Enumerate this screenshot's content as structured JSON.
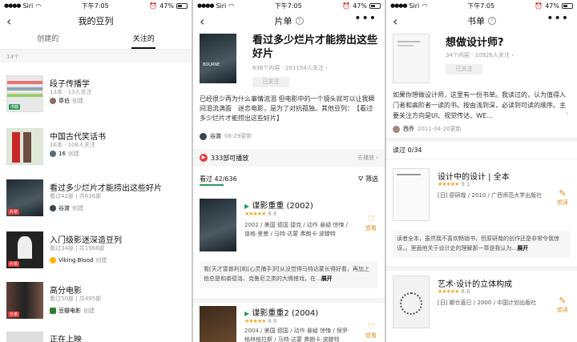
{
  "status": {
    "carrier": "Siri",
    "time": "下午7:05",
    "battery": "47%"
  },
  "p1": {
    "title": "我的豆列",
    "tabs": [
      "创建的",
      "关注的"
    ],
    "count": "14个",
    "items": [
      {
        "title": "段子传播学",
        "meta": "13本 · 13人关注",
        "author": "章伯",
        "role": "创建",
        "tag": "书籍"
      },
      {
        "title": "中国古代笑话书",
        "meta": "16本 · 108人关注",
        "author": "16",
        "role": "创建",
        "tag": ""
      },
      {
        "title": "看过多少烂片才能捞出这些好片",
        "meta": "看过42部 | 共636部",
        "author": "谷渡",
        "role": "创建",
        "tag": "片单"
      },
      {
        "title": "入门级影迷深造豆列",
        "meta": "看过34部 | 共1988部",
        "author": "Viking Blood",
        "role": "创建",
        "tag": "片单"
      },
      {
        "title": "高分电影",
        "meta": "看过50部 | 共495部",
        "author": "豆瓣电影",
        "role": "创建",
        "tag": "片单"
      },
      {
        "title": "正在上映",
        "meta": "",
        "author": "",
        "role": "",
        "tag": ""
      }
    ]
  },
  "p2": {
    "nav": "片单",
    "title": "看过多少烂片才能捞出这些好片",
    "meta": "636个内容 · 201154人关注",
    "follow": "已关注",
    "desc": "已经很少再为什么事情流泪 但电影中的一个镜头就可以让我瞬间泪流满面　迷恋电影，是为了对抗孤独。其他豆列：　【看过多少烂片才能捞出这些好片】",
    "author": "谷渡",
    "date": "08-29更新",
    "play": "333部可播放",
    "playlink": "去播放",
    "watched": "看过 42/636",
    "filter": "筛选",
    "movies": [
      {
        "title": "谍影重重 (2002)",
        "rating": "8.6",
        "info": "2002 / 美国 德国 捷克 / 动作 悬疑 惊悚 / 道格·里曼 / 马特·达蒙 弗朗卡·波滕特",
        "want": "想看",
        "quote": "看[天才雷普利]和[心灵捕手]时从没觉得马特达蒙长得好看，再加上他总是和裘德洛、克鲁尼之类的大牌搭戏，在...",
        "expand": "展开"
      },
      {
        "title": "谍影重重2 (2004)",
        "rating": "8.6",
        "info": "2004 / 美国 德国 / 动作 悬疑 惊悚 / 保罗·格林格拉斯 / 马特·达蒙 弗朗卡·波滕特",
        "want": "想看"
      }
    ]
  },
  "p3": {
    "nav": "书单",
    "title": "想做设计师?",
    "meta": "34个内容 · 10926人关注",
    "follow": "已关注",
    "desc": "如果你想做设计师，这里有一份书单。我读过的，认为值得入门者和高阶者一读的书。按由浅到深，必读到可读的顺序。主要关注方向是UI、视觉传达、WE...",
    "author": "西乔",
    "date": "2011-04-20更新",
    "read": "读过 0/34",
    "books": [
      {
        "title": "设计中的设计 | 全本",
        "rating": "9.1",
        "info": "[日] 原研哉 / 2010 / 广西师范大学出版社",
        "want": "想读",
        "quote": "读者全本，虽然我不喜欢畅销书，但原研哉的创作还是非常令我惊讶。。里面他关于设计史的理解那一章是我认为...",
        "expand": "展开"
      },
      {
        "title": "艺术·设计的立体构成",
        "rating": "8.6",
        "info": "[日] 朝仓直巳 / 2000 / 中国计划出版社",
        "want": "想读"
      }
    ]
  }
}
